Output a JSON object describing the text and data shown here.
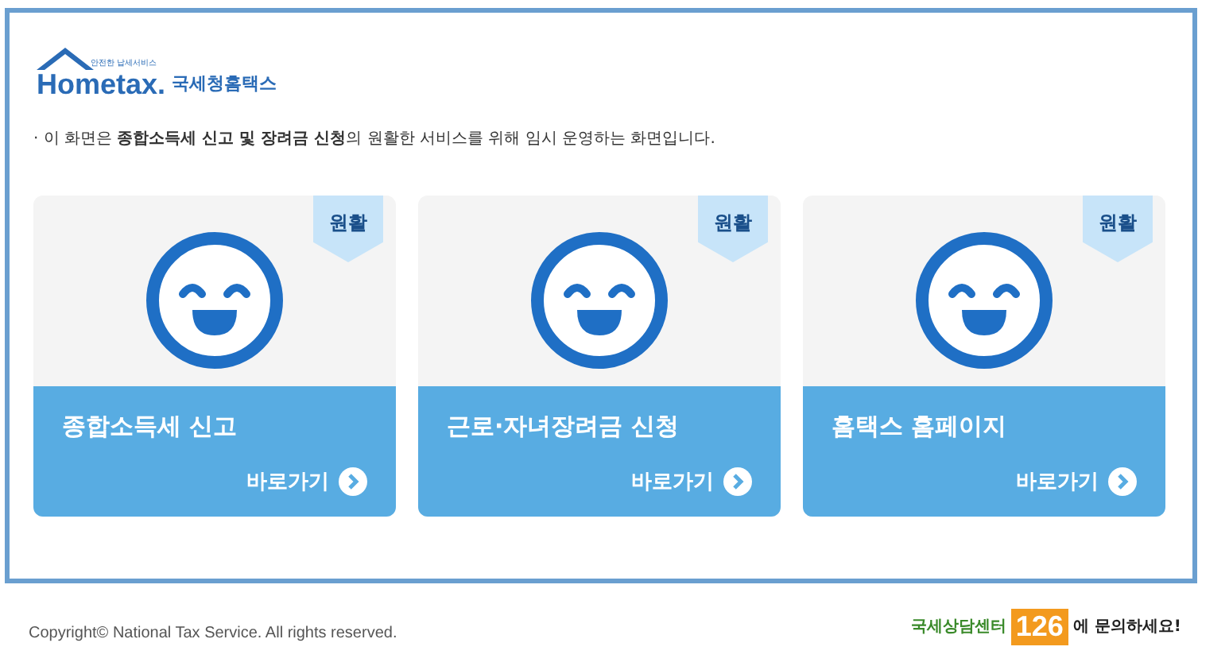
{
  "logo": {
    "tagline": "안전한 납세서비스",
    "brand": "Hometax.",
    "name": "국세청홈택스"
  },
  "notice": "· 이 화면은 **종합소득세 신고 및 장려금 신청**의 원활한 서비스를 위해 임시 운영하는 화면입니다.",
  "cards": [
    {
      "status": "원활",
      "title": "종합소득세 신고",
      "link": "바로가기"
    },
    {
      "status": "원활",
      "title": "근로·자녀장려금 신청",
      "link": "바로가기"
    },
    {
      "status": "원활",
      "title": "홈택스 홈페이지",
      "link": "바로가기"
    }
  ],
  "footer": {
    "copyright": "Copyright© National Tax Service. All rights reserved.",
    "center_label": "국세상담센터",
    "center_number": "126",
    "center_suffix": "에 문의하세요!"
  }
}
